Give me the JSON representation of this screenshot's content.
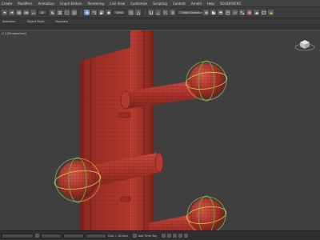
{
  "menubar": {
    "items": [
      "Create",
      "Modifiers",
      "Animation",
      "Graph Editors",
      "Rendering",
      "Civil View",
      "Customize",
      "Scripting",
      "Content",
      "Arnold",
      "Help",
      "SOLIDROCKS"
    ]
  },
  "toolbar": {
    "selection_filter": "All",
    "named_selection": "Create Selection Se"
  },
  "ribbon": {
    "tabs": [
      "Selection",
      "Object Paint",
      "Populate"
    ]
  },
  "viewport": {
    "label": "[+] [Perspective]"
  },
  "status": {
    "grid_label": "Grid = 10.0cm",
    "time_tag_label": "Add Time Tag"
  },
  "colors": {
    "model": "#a8322a",
    "viewport_bg": "#3f3f3f",
    "gizmo_yellow": "#d7c84a",
    "gizmo_green": "#5fbf3f"
  }
}
